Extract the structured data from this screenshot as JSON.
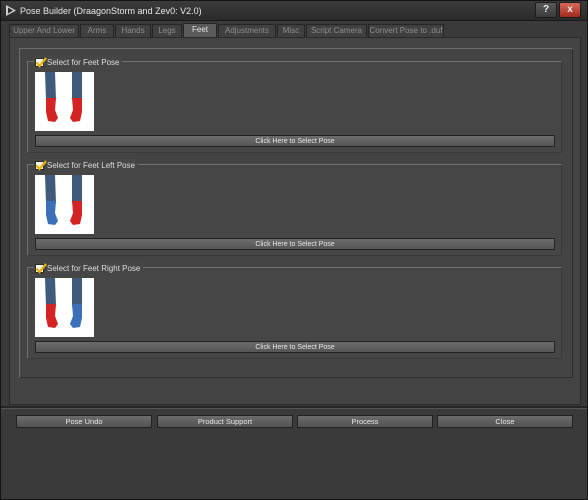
{
  "window": {
    "title": "Pose Builder (DraagonStorm and Zev0: V2.0)",
    "help_label": "?",
    "close_label": "x"
  },
  "tabs": [
    {
      "label": "Upper And Lower",
      "active": false
    },
    {
      "label": "Arms",
      "active": false
    },
    {
      "label": "Hands",
      "active": false
    },
    {
      "label": "Legs",
      "active": false
    },
    {
      "label": "Feet",
      "active": true
    },
    {
      "label": "Adjustments",
      "active": false
    },
    {
      "label": "Misc",
      "active": false
    },
    {
      "label": "Script Camera",
      "active": false
    },
    {
      "label": "Convert Pose to .duf",
      "active": false
    }
  ],
  "groups": [
    {
      "label": "Select for Feet Pose",
      "checked": true,
      "button": "Click Here to Select Pose",
      "left_foot_color": "#d42323",
      "right_foot_color": "#d42323"
    },
    {
      "label": "Select for Feet Left Pose",
      "checked": true,
      "button": "Click Here to Select Pose",
      "left_foot_color": "#3b6fb8",
      "right_foot_color": "#d42323"
    },
    {
      "label": "Select for Feet Right Pose",
      "checked": true,
      "button": "Click Here to Select Pose",
      "left_foot_color": "#d42323",
      "right_foot_color": "#3b6fb8"
    }
  ],
  "actions": {
    "undo": "Pose Undo",
    "support": "Product Support",
    "process": "Process",
    "close": "Close"
  },
  "colors": {
    "check_mark": "#e8b400",
    "leg_color": "#3f5a7a"
  }
}
